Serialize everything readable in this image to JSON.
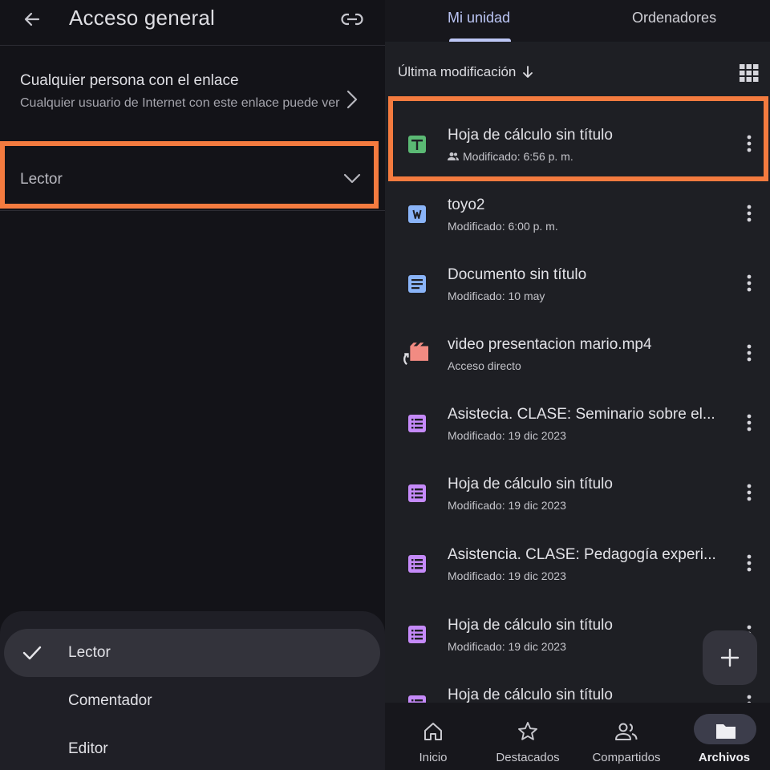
{
  "left": {
    "title": "Acceso general",
    "access": {
      "title": "Cualquier persona con el enlace",
      "description": "Cualquier usuario de Internet con este enlace puede ver"
    },
    "role_selected": "Lector",
    "sheet_options": [
      {
        "label": "Lector",
        "selected": true
      },
      {
        "label": "Comentador",
        "selected": false
      },
      {
        "label": "Editor",
        "selected": false
      }
    ]
  },
  "right": {
    "tabs": [
      {
        "label": "Mi unidad",
        "active": true
      },
      {
        "label": "Ordenadores",
        "active": false
      }
    ],
    "sort_label": "Última modificación",
    "files": [
      {
        "name": "Hoja de cálculo sin título",
        "meta": "Modificado: 6:56 p. m.",
        "type": "sheets",
        "shared": true
      },
      {
        "name": "toyo2",
        "meta": "Modificado: 6:00 p. m.",
        "type": "word",
        "shared": false
      },
      {
        "name": "Documento sin título",
        "meta": "Modificado: 10 may",
        "type": "docs",
        "shared": false
      },
      {
        "name": "video presentacion mario.mp4",
        "meta": "Acceso directo",
        "type": "video-shortcut",
        "shared": false
      },
      {
        "name": "Asistecia. CLASE: Seminario sobre el...",
        "meta": "Modificado: 19 dic 2023",
        "type": "forms",
        "shared": false
      },
      {
        "name": "Hoja de cálculo sin título",
        "meta": "Modificado: 19 dic 2023",
        "type": "forms",
        "shared": false
      },
      {
        "name": "Asistencia. CLASE: Pedagogía experi...",
        "meta": "Modificado: 19 dic 2023",
        "type": "forms",
        "shared": false
      },
      {
        "name": "Hoja de cálculo sin título",
        "meta": "Modificado: 19 dic 2023",
        "type": "forms",
        "shared": false
      },
      {
        "name": "Hoja de cálculo sin título",
        "meta": "",
        "type": "forms",
        "shared": false
      }
    ],
    "nav": [
      {
        "label": "Inicio",
        "icon": "home-icon",
        "active": false
      },
      {
        "label": "Destacados",
        "icon": "star-icon",
        "active": false
      },
      {
        "label": "Compartidos",
        "icon": "people-icon",
        "active": false
      },
      {
        "label": "Archivos",
        "icon": "folder-icon",
        "active": true
      }
    ]
  },
  "colors": {
    "highlight": "#f47b3f",
    "accent": "#bcc6f5",
    "sheets": "#5bb974",
    "word": "#8ab4f8",
    "docs": "#8ab4f8",
    "forms": "#c58af9",
    "video": "#f28b82"
  }
}
